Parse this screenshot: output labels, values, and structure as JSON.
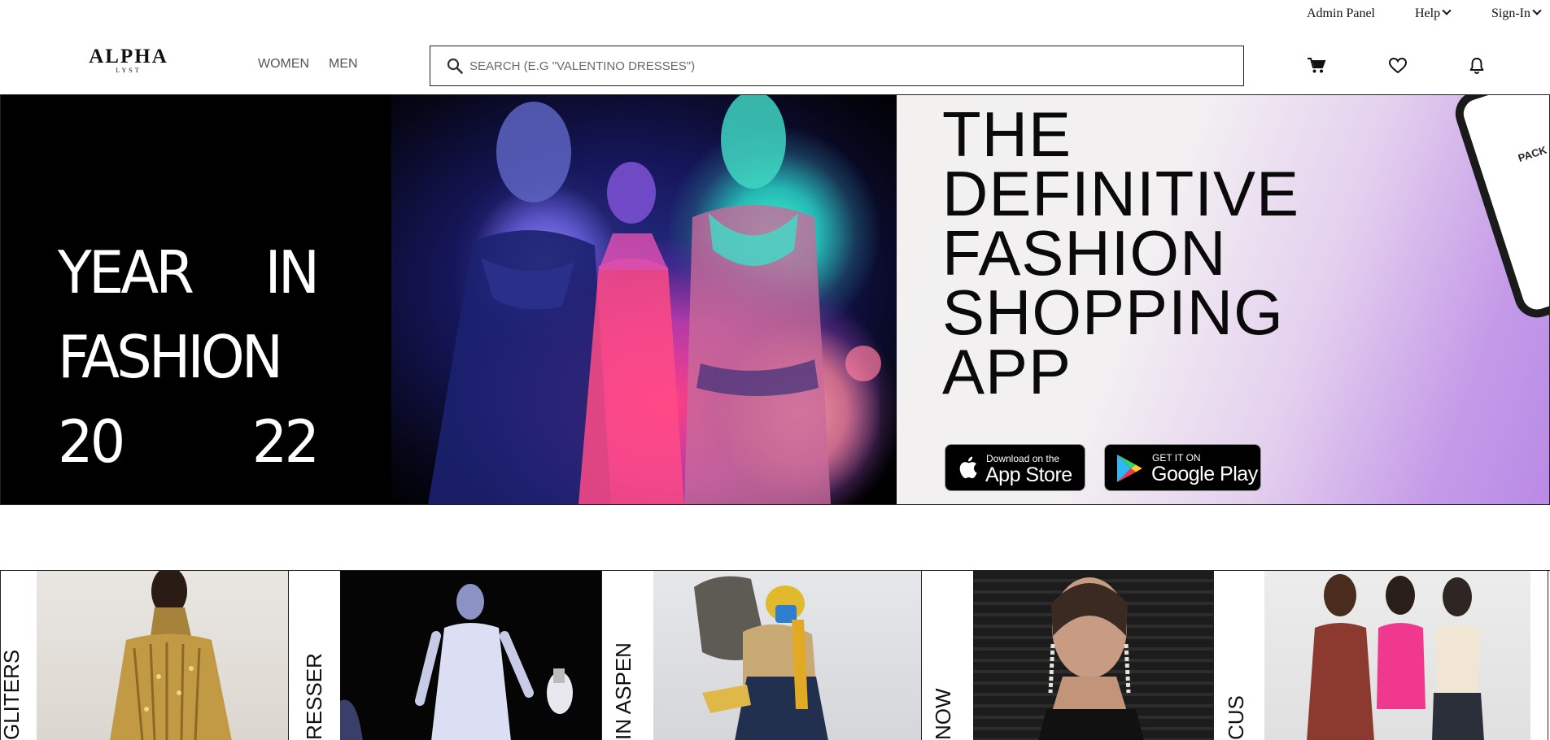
{
  "utility": {
    "admin_panel": "Admin Panel",
    "help": "Help",
    "sign_in": "Sign-In"
  },
  "header": {
    "logo_main": "ALPHA",
    "logo_sub": "LYST",
    "nav": [
      "WOMEN",
      "MEN"
    ],
    "search_placeholder": "SEARCH (E.G \"VALENTINO DRESSES\")",
    "icons": [
      "cart-icon",
      "heart-icon",
      "bell-icon"
    ]
  },
  "hero": {
    "year_title": [
      "YEAR",
      "IN",
      "FASHION",
      "20",
      "22"
    ],
    "app_title": [
      "THE",
      "DEFINITIVE",
      "FASHION",
      "SHOPPING",
      "APP"
    ],
    "phone_text": "PACK",
    "app_store": {
      "small": "Download on the",
      "big": "App Store"
    },
    "google_play": {
      "small": "GET IT ON",
      "big": "Google Play"
    }
  },
  "carousel": {
    "labels": [
      "GLITERS",
      "RESSER",
      "IN ASPEN",
      "NOW",
      "CUS"
    ]
  },
  "colors": {
    "accent_dark": "#000000",
    "hero_right_gradient_end": "#b98ae6"
  }
}
